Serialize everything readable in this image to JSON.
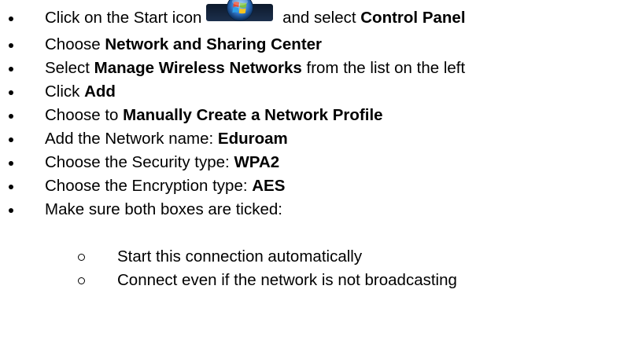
{
  "steps": [
    {
      "pre": "Click on the Start icon",
      "post": " and select ",
      "bold": "Control Panel",
      "icon": "windows-start-orb-icon"
    },
    {
      "pre": "Choose ",
      "bold": "Network and Sharing Center"
    },
    {
      "pre": "Select ",
      "bold": "Manage Wireless Networks",
      "post": " from the list on the left"
    },
    {
      "pre": "Click ",
      "bold": "Add"
    },
    {
      "pre": "Choose to ",
      "bold": "Manually Create a Network Profile"
    },
    {
      "pre": "Add the Network name: ",
      "bold": "Eduroam"
    },
    {
      "pre": "Choose the Security type: ",
      "bold": "WPA2"
    },
    {
      "pre": "Choose the Encryption type: ",
      "bold": "AES"
    },
    {
      "pre": "Make sure both boxes are ticked:"
    }
  ],
  "substeps": [
    "Start this connection automatically",
    "Connect even if the network is not broadcasting"
  ],
  "colors": {
    "text": "#000000",
    "background": "#ffffff",
    "orb_blue": "#2f74c8",
    "flag_red": "#e8452c",
    "flag_green": "#7cc142",
    "flag_blue": "#2d9ee6",
    "flag_yellow": "#f6c320"
  }
}
